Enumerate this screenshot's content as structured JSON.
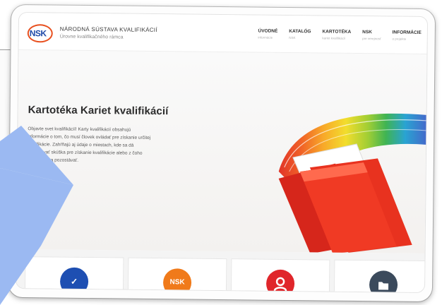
{
  "header": {
    "logo_text": "NSK",
    "brand_title": "NÁRODNÁ SÚSTAVA KVALIFIKÁCIÍ",
    "brand_subtitle": "Úrovne kvalifikačného rámca"
  },
  "nav": [
    {
      "label": "ÚVODNÉ",
      "sub": "informácie"
    },
    {
      "label": "KATALÓG",
      "sub": "NSK"
    },
    {
      "label": "KARTOTÉKA",
      "sub": "kariet kvalifikácií"
    },
    {
      "label": "NSK",
      "sub": "pre verejnosť"
    },
    {
      "label": "INFORMÁCIE",
      "sub": "o projekte"
    }
  ],
  "hero": {
    "title": "Kartotéka Kariet kvalifikácií",
    "lines": [
      "Objavte svet kvalifikácií! Karty kvalifikácií obsahujú",
      "informácie o tom, čo musí človek ovládať pre získanie určitej",
      "kvalifikácie. Zahŕňajú aj údaje o miestach, kde sa dá",
      "absolvovať skúška pre získanie kvalifikácie alebo z čoho",
      "bude skúška pozostávať."
    ]
  },
  "cards": [
    {
      "icon": "check-icon",
      "symbol": "✓",
      "color": "#1e4fb2"
    },
    {
      "icon": "nsk-icon",
      "symbol": "NSK",
      "color": "#f07a1a"
    },
    {
      "icon": "user-icon",
      "symbol": "",
      "color": "#e0262b"
    },
    {
      "icon": "folder-icon",
      "symbol": "",
      "color": "#3b4a5c"
    }
  ],
  "colors": {
    "arrow": "#9bb9f2",
    "brand_blue": "#1f4aa8",
    "brand_orange": "#e8501f"
  }
}
